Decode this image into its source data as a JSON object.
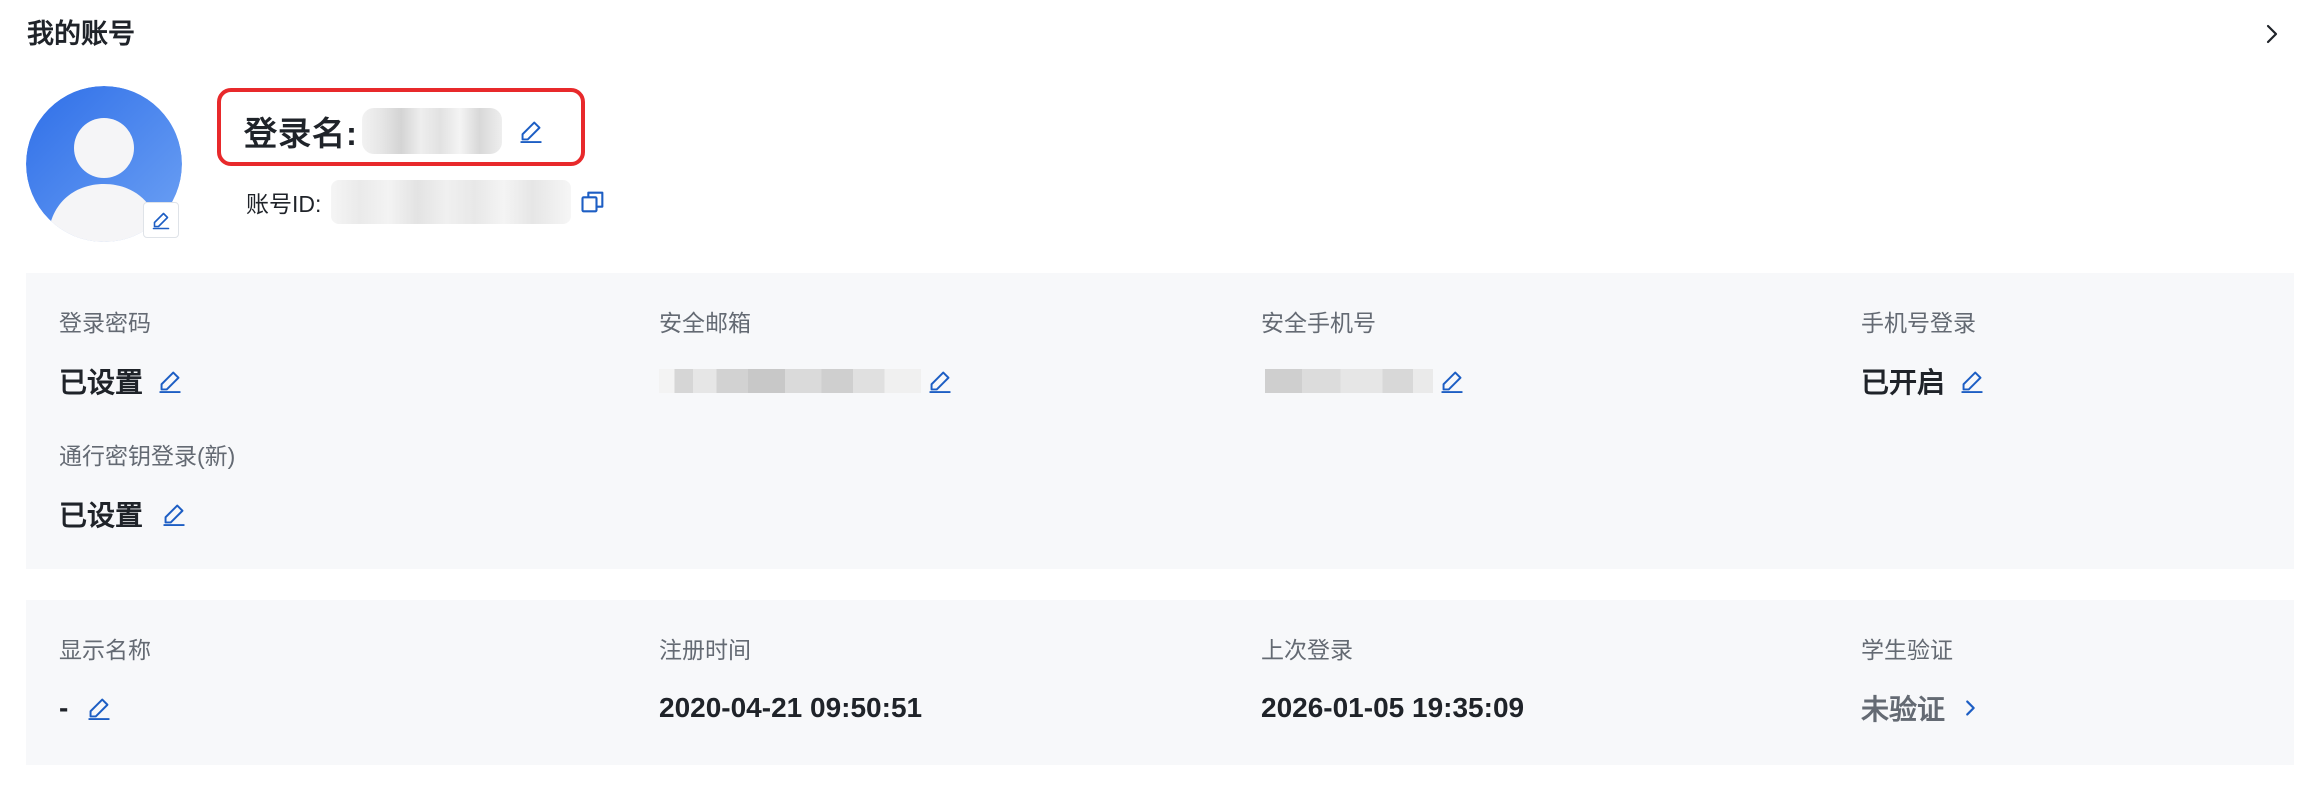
{
  "header": {
    "title": "我的账号",
    "more_icon": "chevron-right-icon"
  },
  "profile": {
    "avatar_icon": "user-avatar-icon",
    "login_name_label": "登录名:",
    "account_id_label": "账号ID:",
    "copy_icon": "copy-icon"
  },
  "security": {
    "fields": [
      {
        "label": "登录密码",
        "value": "已设置"
      },
      {
        "label": "安全邮箱",
        "value": ""
      },
      {
        "label": "安全手机号",
        "value": ""
      },
      {
        "label": "手机号登录",
        "value": "已开启"
      },
      {
        "label": "通行密钥登录(新)",
        "value": "已设置"
      }
    ]
  },
  "info": {
    "fields": [
      {
        "label": "显示名称",
        "value": "-"
      },
      {
        "label": "注册时间",
        "value": "2020-04-21 09:50:51"
      },
      {
        "label": "上次登录",
        "value": "2026-01-05 19:35:09"
      },
      {
        "label": "学生验证",
        "value": "未验证"
      }
    ]
  },
  "colors": {
    "link_blue": "#1d5ec4",
    "highlight_red": "#e8292b",
    "panel_bg": "#f7f8fa",
    "label_gray": "#646a73",
    "text_dark": "#1f2329"
  }
}
